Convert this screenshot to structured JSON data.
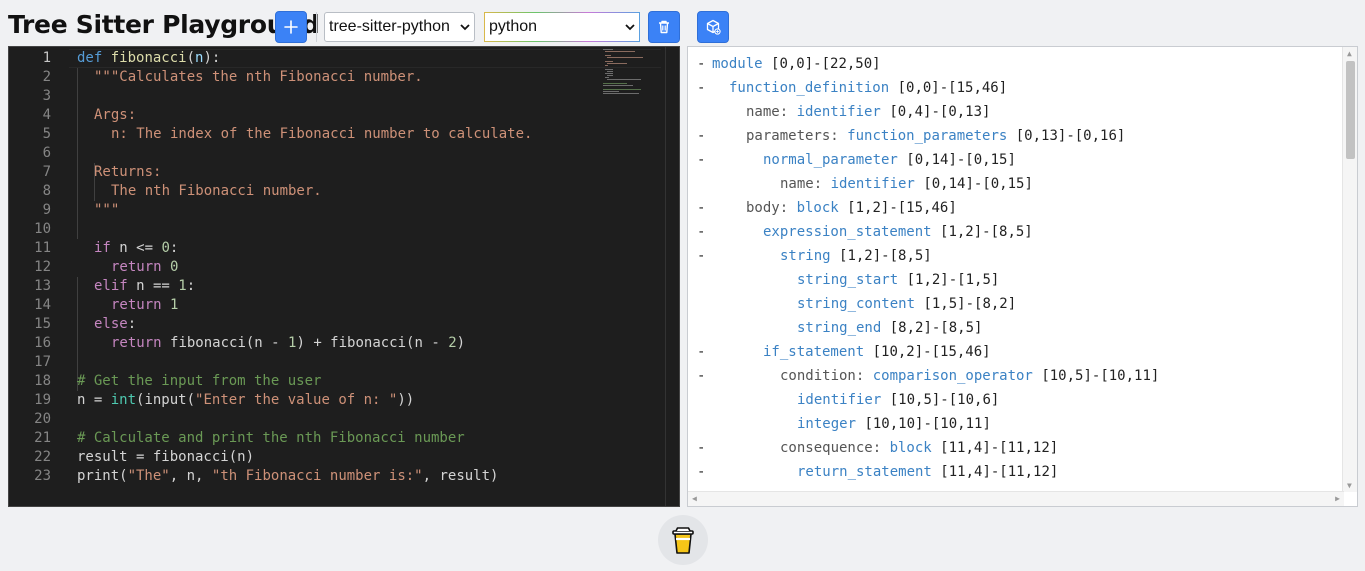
{
  "header": {
    "title": "Tree Sitter Playground",
    "parser_select": "tree-sitter-python",
    "language_select": "python"
  },
  "editor": {
    "lines": [
      {
        "n": "1"
      },
      {
        "n": "2"
      },
      {
        "n": "3"
      },
      {
        "n": "4"
      },
      {
        "n": "5"
      },
      {
        "n": "6"
      },
      {
        "n": "7"
      },
      {
        "n": "8"
      },
      {
        "n": "9"
      },
      {
        "n": "10"
      },
      {
        "n": "11"
      },
      {
        "n": "12"
      },
      {
        "n": "13"
      },
      {
        "n": "14"
      },
      {
        "n": "15"
      },
      {
        "n": "16"
      },
      {
        "n": "17"
      },
      {
        "n": "18"
      },
      {
        "n": "19"
      },
      {
        "n": "20"
      },
      {
        "n": "21"
      },
      {
        "n": "22"
      },
      {
        "n": "23"
      }
    ],
    "code": {
      "l1_def": "def",
      "l1_fn": "fibonacci",
      "l1_p1": "(",
      "l1_arg": "n",
      "l1_p2": "):",
      "l2": "\"\"\"Calculates the nth Fibonacci number.",
      "l4": "Args:",
      "l5": "n: The index of the Fibonacci number to calculate.",
      "l7": "Returns:",
      "l8": "The nth Fibonacci number.",
      "l9": "\"\"\"",
      "l11_kw": "if",
      "l11_a": " n <= ",
      "l11_num": "0",
      "l11_b": ":",
      "l12_kw": "return",
      "l12_num": "0",
      "l13_kw": "elif",
      "l13_a": " n == ",
      "l13_num": "1",
      "l13_b": ":",
      "l14_kw": "return",
      "l14_num": "1",
      "l15_kw": "else",
      "l15_b": ":",
      "l16_kw": "return",
      "l16_a": "fibonacci(n - ",
      "l16_n1": "1",
      "l16_b": ") + fibonacci(n - ",
      "l16_n2": "2",
      "l16_c": ")",
      "l18": "# Get the input from the user",
      "l19_a": "n = ",
      "l19_int": "int",
      "l19_b": "(input(",
      "l19_str": "\"Enter the value of n: \"",
      "l19_c": "))",
      "l21": "# Calculate and print the nth Fibonacci number",
      "l22": "result = fibonacci(n)",
      "l23_a": "print(",
      "l23_s1": "\"The\"",
      "l23_b": ", n, ",
      "l23_s2": "\"th Fibonacci number is:\"",
      "l23_c": ", result)"
    }
  },
  "tree": {
    "rows": [
      {
        "dash": "-",
        "field": "",
        "type": "module",
        "range": "[0,0]-[22,50]"
      },
      {
        "dash": "-",
        "field": "",
        "type": "function_definition",
        "range": "[0,0]-[15,46]"
      },
      {
        "dash": "",
        "field": "name: ",
        "type": "identifier",
        "range": "[0,4]-[0,13]"
      },
      {
        "dash": "-",
        "field": "parameters: ",
        "type": "function_parameters",
        "range": "[0,13]-[0,16]"
      },
      {
        "dash": "-",
        "field": "",
        "type": "normal_parameter",
        "range": "[0,14]-[0,15]"
      },
      {
        "dash": "",
        "field": "name: ",
        "type": "identifier",
        "range": "[0,14]-[0,15]"
      },
      {
        "dash": "-",
        "field": "body: ",
        "type": "block",
        "range": "[1,2]-[15,46]"
      },
      {
        "dash": "-",
        "field": "",
        "type": "expression_statement",
        "range": "[1,2]-[8,5]"
      },
      {
        "dash": "-",
        "field": "",
        "type": "string",
        "range": "[1,2]-[8,5]"
      },
      {
        "dash": "",
        "field": "",
        "type": "string_start",
        "range": "[1,2]-[1,5]"
      },
      {
        "dash": "",
        "field": "",
        "type": "string_content",
        "range": "[1,5]-[8,2]"
      },
      {
        "dash": "",
        "field": "",
        "type": "string_end",
        "range": "[8,2]-[8,5]"
      },
      {
        "dash": "-",
        "field": "",
        "type": "if_statement",
        "range": "[10,2]-[15,46]"
      },
      {
        "dash": "-",
        "field": "condition: ",
        "type": "comparison_operator",
        "range": "[10,5]-[10,11]"
      },
      {
        "dash": "",
        "field": "",
        "type": "identifier",
        "range": "[10,5]-[10,6]"
      },
      {
        "dash": "",
        "field": "",
        "type": "integer",
        "range": "[10,10]-[10,11]"
      },
      {
        "dash": "-",
        "field": "consequence: ",
        "type": "block",
        "range": "[11,4]-[11,12]"
      },
      {
        "dash": "-",
        "field": "",
        "type": "return_statement",
        "range": "[11,4]-[11,12]"
      }
    ]
  },
  "icons": {
    "add": "plus-icon",
    "delete": "trash-icon",
    "open": "package-icon",
    "footer": "coffee-cup-icon"
  },
  "colors": {
    "accent": "#3b82f6",
    "editor_bg": "#1e1e1e",
    "tree_type": "#3b82c4"
  }
}
